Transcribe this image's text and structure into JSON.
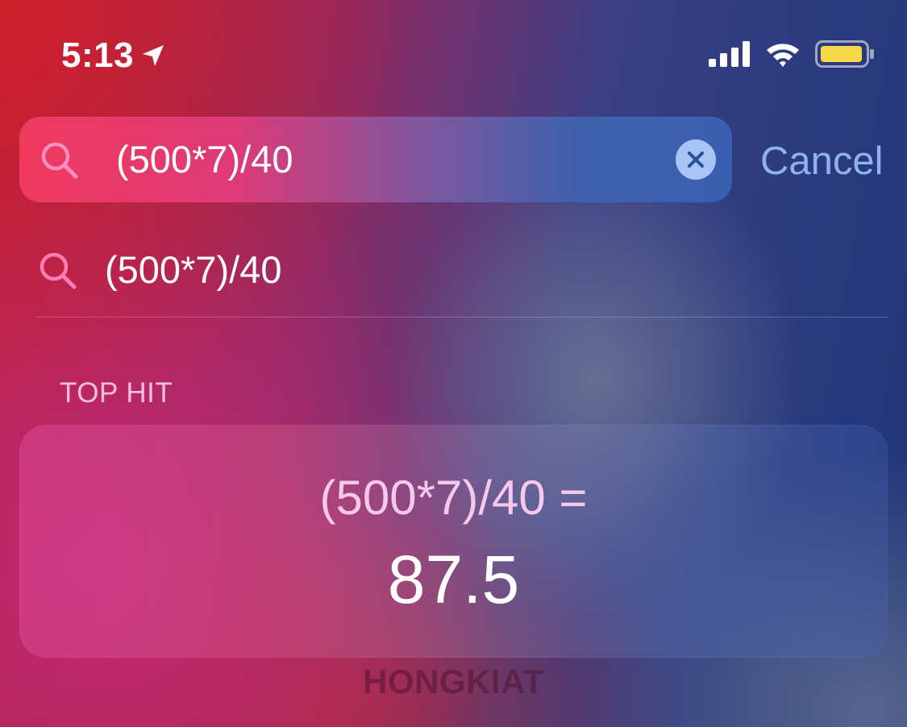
{
  "status_bar": {
    "time": "5:13",
    "icons": [
      "location-arrow-icon",
      "cellular-signal-icon",
      "wifi-icon",
      "battery-icon"
    ],
    "battery_color": "#f5d949"
  },
  "search": {
    "query": "(500*7)/40",
    "icon": "search-icon",
    "clear_icon": "clear-icon",
    "cancel_label": "Cancel"
  },
  "suggestions": [
    {
      "text": "(500*7)/40",
      "icon": "search-icon"
    }
  ],
  "top_hit": {
    "header": "TOP HIT",
    "expression": "(500*7)/40 =",
    "result": "87.5"
  },
  "watermark": "HONGKIAT",
  "colors": {
    "accent_blue": "#8fb1f0",
    "search_icon_pink": "#ff7fb5"
  }
}
